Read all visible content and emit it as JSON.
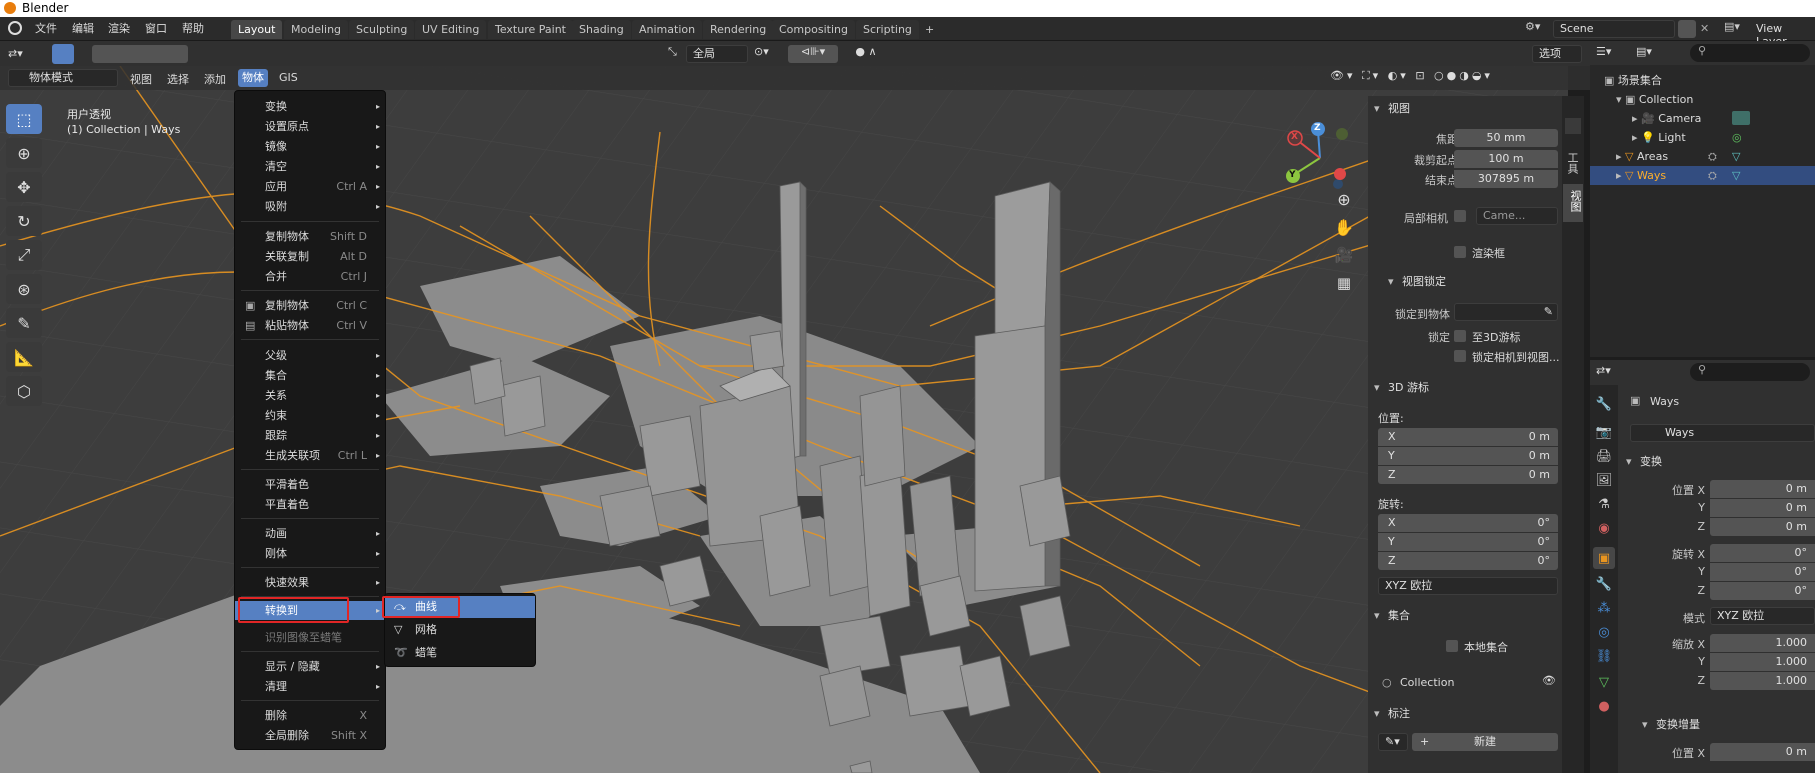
{
  "app": {
    "title": "Blender"
  },
  "topmenu": [
    "文件",
    "编辑",
    "渲染",
    "窗口",
    "帮助"
  ],
  "workspaces": [
    "Layout",
    "Modeling",
    "Sculpting",
    "UV Editing",
    "Texture Paint",
    "Shading",
    "Animation",
    "Rendering",
    "Compositing",
    "Scripting"
  ],
  "workspace_add": "+",
  "scene": {
    "name": "Scene",
    "view_layer": "View Layer"
  },
  "header": {
    "transform_orientation": "全局",
    "options": "选项",
    "mode": "物体模式",
    "menus": [
      "视图",
      "选择",
      "添加",
      "物体",
      "GIS"
    ]
  },
  "viewport": {
    "perspective": "用户透视",
    "info": "(1) Collection | Ways"
  },
  "gizmo": {
    "x": "X",
    "y": "Y",
    "z": "Z"
  },
  "object_menu": {
    "items": [
      {
        "label": "变换",
        "shortcut": "",
        "arrow": "▸"
      },
      {
        "label": "设置原点",
        "shortcut": "",
        "arrow": "▸"
      },
      {
        "label": "镜像",
        "shortcut": "",
        "arrow": "▸"
      },
      {
        "label": "清空",
        "shortcut": "",
        "arrow": "▸"
      },
      {
        "label": "应用",
        "shortcut": "Ctrl A",
        "arrow": "▸"
      },
      {
        "label": "吸附",
        "shortcut": "",
        "arrow": "▸"
      },
      {
        "label": "复制物体",
        "shortcut": "Shift D",
        "arrow": ""
      },
      {
        "label": "关联复制",
        "shortcut": "Alt D",
        "arrow": ""
      },
      {
        "label": "合并",
        "shortcut": "Ctrl J",
        "arrow": ""
      },
      {
        "label": "复制物体",
        "shortcut": "Ctrl C",
        "arrow": ""
      },
      {
        "label": "粘贴物体",
        "shortcut": "Ctrl V",
        "arrow": ""
      },
      {
        "label": "父级",
        "shortcut": "",
        "arrow": "▸"
      },
      {
        "label": "集合",
        "shortcut": "",
        "arrow": "▸"
      },
      {
        "label": "关系",
        "shortcut": "",
        "arrow": "▸"
      },
      {
        "label": "约束",
        "shortcut": "",
        "arrow": "▸"
      },
      {
        "label": "跟踪",
        "shortcut": "",
        "arrow": "▸"
      },
      {
        "label": "生成关联项",
        "shortcut": "Ctrl L",
        "arrow": "▸"
      },
      {
        "label": "平滑着色",
        "shortcut": "",
        "arrow": ""
      },
      {
        "label": "平直着色",
        "shortcut": "",
        "arrow": ""
      },
      {
        "label": "动画",
        "shortcut": "",
        "arrow": "▸"
      },
      {
        "label": "刚体",
        "shortcut": "",
        "arrow": "▸"
      },
      {
        "label": "快速效果",
        "shortcut": "",
        "arrow": "▸"
      },
      {
        "label": "转换到",
        "shortcut": "",
        "arrow": "▸"
      },
      {
        "label": "识别图像至蜡笔",
        "shortcut": "",
        "arrow": ""
      },
      {
        "label": "显示 / 隐藏",
        "shortcut": "",
        "arrow": "▸"
      },
      {
        "label": "清理",
        "shortcut": "",
        "arrow": "▸"
      },
      {
        "label": "删除",
        "shortcut": "X",
        "arrow": ""
      },
      {
        "label": "全局删除",
        "shortcut": "Shift X",
        "arrow": ""
      }
    ]
  },
  "convert_menu": {
    "items": [
      "曲线",
      "网格",
      "蜡笔"
    ]
  },
  "npanel": {
    "view_header": "视图",
    "focal_label": "焦距",
    "focal": "50 mm",
    "clip_start_label": "裁剪起点",
    "clip_start": "100 m",
    "clip_end_label": "结束点",
    "clip_end": "307895 m",
    "local_camera_label": "局部相机",
    "local_camera": "Came...",
    "render_region": "渲染框",
    "view_lock_header": "视图锁定",
    "lock_object_label": "锁定到物体",
    "lock_label": "锁定",
    "lock_cursor": "至3D游标",
    "lock_camera": "锁定相机到视图...",
    "cursor_header": "3D 游标",
    "location_label": "位置:",
    "loc": [
      {
        "k": "X",
        "v": "0 m"
      },
      {
        "k": "Y",
        "v": "0 m"
      },
      {
        "k": "Z",
        "v": "0 m"
      }
    ],
    "rotation_label": "旋转:",
    "rot": [
      {
        "k": "X",
        "v": "0°"
      },
      {
        "k": "Y",
        "v": "0°"
      },
      {
        "k": "Z",
        "v": "0°"
      }
    ],
    "rot_mode": "XYZ 欧拉",
    "collection_header": "集合",
    "local_collection": "本地集合",
    "collection_item": "Collection",
    "annotation_header": "标注",
    "new_button": "新建",
    "tabs": [
      "工具",
      "视图"
    ]
  },
  "outliner": {
    "root": "场景集合",
    "rows": [
      {
        "label": "Collection",
        "depth": 1
      },
      {
        "label": "Camera",
        "depth": 2
      },
      {
        "label": "Light",
        "depth": 2
      },
      {
        "label": "Areas",
        "depth": 1
      },
      {
        "label": "Ways",
        "depth": 1
      }
    ]
  },
  "properties": {
    "object_name": "Ways",
    "data_name": "Ways",
    "transform_header": "变换",
    "loc_x_label": "位置 X",
    "loc_x": "0 m",
    "loc_y_label": "Y",
    "loc_y": "0 m",
    "loc_z_label": "Z",
    "loc_z": "0 m",
    "rot_x_label": "旋转 X",
    "rot_x": "0°",
    "rot_y_label": "Y",
    "rot_y": "0°",
    "rot_z_label": "Z",
    "rot_z": "0°",
    "mode_label": "模式",
    "mode": "XYZ 欧拉",
    "scale_x_label": "缩放 X",
    "scale_x": "1.000",
    "scale_y_label": "Y",
    "scale_y": "1.000",
    "scale_z_label": "Z",
    "scale_z": "1.000",
    "delta_header": "变换增量",
    "delta_loc_label": "位置 X",
    "delta_loc": "0 m"
  },
  "colors": {
    "accent": "#5680c2",
    "highlight_red": "#e12626",
    "roads": "#e89520",
    "buildings": "#8e8e8e"
  }
}
